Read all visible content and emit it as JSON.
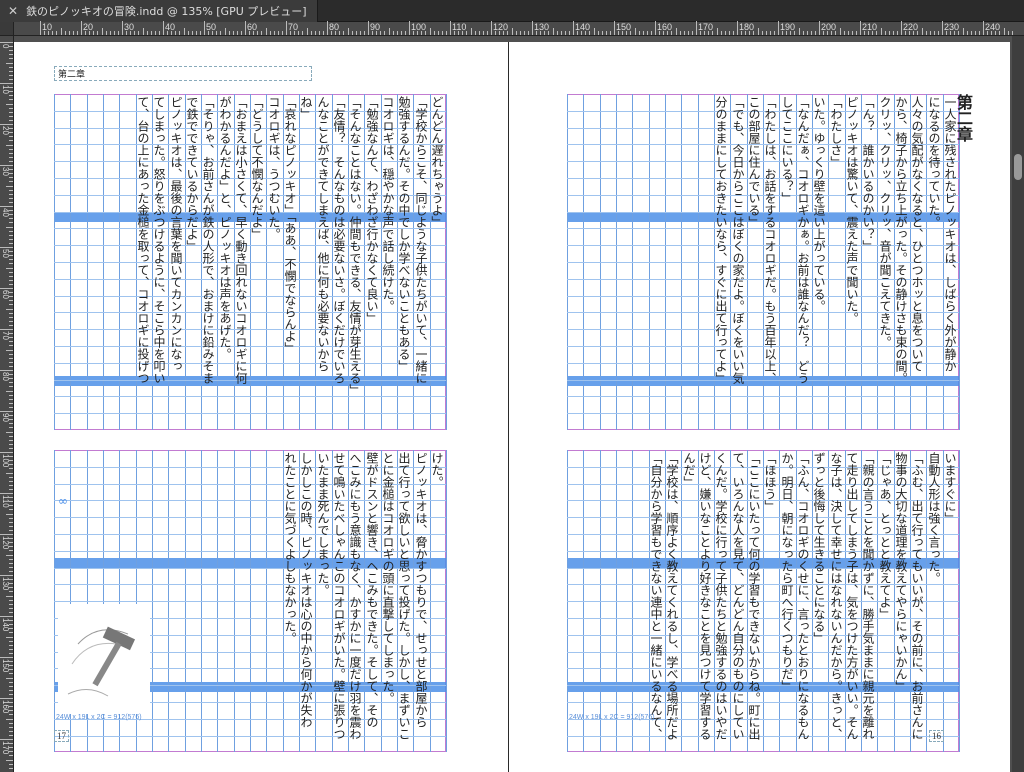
{
  "window": {
    "close_icon": "close-icon",
    "tab_title": "鉄のピノッキオの冒険.indd @ 135% [GPU プレビュー]"
  },
  "ruler": {
    "h_labels": [
      "10",
      "20",
      "30",
      "40",
      "50",
      "60",
      "70",
      "80",
      "90",
      "100",
      "110",
      "120",
      "130",
      "140",
      "150",
      "160",
      "170",
      "180",
      "190",
      "200",
      "210",
      "220",
      "230",
      "240",
      "250"
    ],
    "v_labels": [
      "0",
      "10",
      "20",
      "30",
      "40",
      "50",
      "60",
      "70",
      "80",
      "90",
      "100",
      "110",
      "120",
      "130",
      "140",
      "150",
      "160",
      "170"
    ]
  },
  "left_page": {
    "running_head": "第二章",
    "grid_info": "24W x 19L x 2C = 912(576)",
    "folio": "17",
    "upper_block": [
      "どんどん遅れちゃうよ」",
      "「学校からこそ、同じような子供たちがいて、一緒に",
      "勉強するんだ。その中でしか学べないこともある」",
      "コオロギは、穏やかな声で話し続けた。",
      "「勉強なんて、わざわざ行かなくて良い」",
      "「そんなことはない。仲間もできる、友情が芽生える」",
      "「友情？　そんなものは必要ないさ。ぼくだけでいろ",
      "んなことができてしまえば、他に何も必要ないから",
      "ね」",
      "「哀れなピノッキオ」「ああ、不憫でならんよ」",
      "コオロギは、うつむいた。",
      "「どうして不憫なんだよ」",
      "「おまえは小さくて、早く動き回れないコオロギに何",
      "がわかるんだよ」と、ピノッキオは声をあげた。",
      "「そりゃ、お前さんが鉄の人形で、おまけに鉛みそま",
      "で鉄でできているからだよ」",
      "ピノッキオは、最後の言葉を聞いてカンカンになっ",
      "てしまった。怒りをぶつけるように、そこら中を叩い",
      "て、台の上にあった金槌を取って、コオロギに投げつ"
    ],
    "lower_block": [
      "けた。",
      "ピノッキオは、脅かすつもりで、せっせと部屋から",
      "出て行って欲しいと思って投げた。しかし、まずいこ",
      "とに金槌はコオロギの頭に直撃してしまった。",
      "壁がドスンと響き、ヘこみもできた。そして、その",
      "へこみにもう意識もなく、かすかに一度だけ羽を震わ",
      "せて鳴いたベしゃんこのコオロギがいた。壁に張りつ",
      "いたまま死んでしまった。",
      "しかしこの時、ピノッキオは心の中から何かが失わ",
      "れたことに気づくよしもなかった。"
    ]
  },
  "right_page": {
    "chapter_title": "第二章",
    "grid_info": "24W x 19L x 2C = 912(576)",
    "folio": "16",
    "upper_block": [
      "一人家に残されたピノッキオは、しばらく外が静か",
      "になるのを待っていた。",
      "人々の気配がなくなると、ひとつホッと息をついて",
      "から、椅子から立ち上がった。その静けさも束の間。",
      "クリッ、クリッ、クリッ、音が聞こえてきた。",
      "「ん？　誰かいるのかい？」",
      "ピノッキオは驚いて、震えた声で聞いた。",
      "「わたしさ」",
      "いた。ゆっくり壁を這い上がっている。",
      "「なんだぁ、コオロギかぁ。お前は誰なんだ？　どう",
      "してここにいる？」",
      "「わたしは、お話をするコオロギだ。もう百年以上、",
      "この部屋に住んでいる」",
      "「でも、今日からここはぼくの家だよ。ぼくをいい気",
      "分のままにしておきたいなら、すぐに出て行ってよ」"
    ],
    "lower_block": [
      "いますぐに」",
      "自動人形は強く言った。",
      "「ふむ、出て行ってもいいが、その前に、お前さんに",
      "物事の大切な道理を教えてやらにゃいかん」",
      "「じゃあ、とっとと教えてよ」",
      "「親の言うことを聞かずに、勝手気ままに親元を離れ",
      "て走り出してしまう子は、気をつけた方がいい。そん",
      "な子は、決して幸せにはなれないんだから。きっと、",
      "ずっと後悔して生きることになる」",
      "「ふん、コオロギのくせに、言ったとおりになるもん",
      "か。明日、朝になったら町へ行くつもりだ」",
      "「ほほう」",
      "「ここにいたって何の学習もできないからね。町に出",
      "て、いろんな人を見て、どんどん自分のものにしてい",
      "くんだ。学校に行って子供たちと勉強するのはいやだ",
      "けど、嫌いなことより好きなことを見つけて学習する",
      "んだ」",
      "「学校は、順序よく教えてくれるし、学べる場所だよ",
      "「自分から学習もできない連中と一緒にいるなんて、"
    ]
  },
  "colors": {
    "grid_line": "#6fa0e0",
    "band": "#4c8fe8",
    "frame": "#c27bd1",
    "pasteboard": "#505050"
  },
  "icons": {
    "hammer": "hammer-icon",
    "link": "chain-link-icon"
  }
}
